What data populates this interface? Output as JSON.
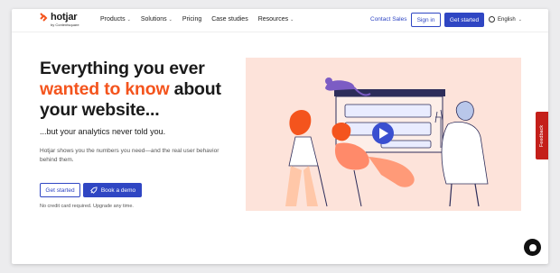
{
  "brand": {
    "name": "hotjar",
    "sub": "by Contentsquare"
  },
  "nav": {
    "items": [
      {
        "label": "Products",
        "chevron": true
      },
      {
        "label": "Solutions",
        "chevron": true
      },
      {
        "label": "Pricing",
        "chevron": false
      },
      {
        "label": "Case studies",
        "chevron": false
      },
      {
        "label": "Resources",
        "chevron": true
      }
    ],
    "contact": "Contact Sales",
    "signin": "Sign in",
    "get_started": "Get started",
    "language": "English"
  },
  "hero": {
    "title_line1": "Everything you ever",
    "title_accent": "wanted to know",
    "title_mid": " about",
    "title_line3": "your website...",
    "subhead": "...but your analytics never told you.",
    "description": "Hotjar shows you the numbers you need—and the real user behavior behind them.",
    "cta_primary": "Get started",
    "cta_demo": "Book a demo",
    "note": "No credit card required. Upgrade any time."
  },
  "feedback_label": "Feedback",
  "colors": {
    "accent": "#f4541d",
    "primary": "#2f46c3",
    "feedback": "#c41f1a",
    "illustration_bg": "#fde3da"
  },
  "icons": {
    "logo": "hotjar-logo-icon",
    "globe": "globe-icon",
    "rocket": "rocket-icon",
    "play": "play-icon",
    "chat": "chat-icon"
  }
}
